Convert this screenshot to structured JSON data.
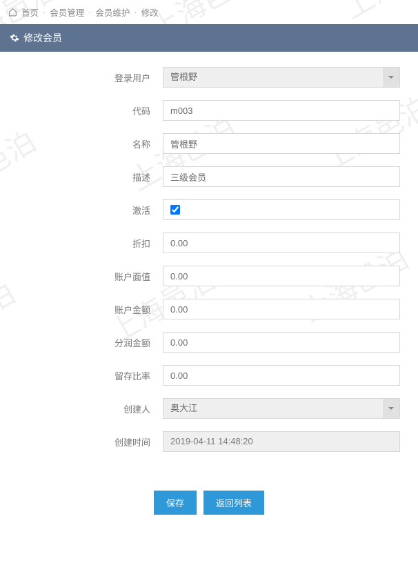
{
  "watermark_text": "上海邑泊",
  "breadcrumb": {
    "home": "首页",
    "l1": "会员管理",
    "l2": "会员维护",
    "l3": "修改"
  },
  "panel": {
    "title": "修改会员"
  },
  "form": {
    "login_user": {
      "label": "登录用户",
      "value": "管根野"
    },
    "code": {
      "label": "代码",
      "value": "m003"
    },
    "name": {
      "label": "名称",
      "value": "管根野"
    },
    "desc": {
      "label": "描述",
      "value": "三级会员"
    },
    "active": {
      "label": "激活",
      "checked": true
    },
    "discount": {
      "label": "折扣",
      "value": "0.00"
    },
    "face_value": {
      "label": "账户面值",
      "value": "0.00"
    },
    "balance": {
      "label": "账户金额",
      "value": "0.00"
    },
    "profit": {
      "label": "分润金额",
      "value": "0.00"
    },
    "retain": {
      "label": "留存比率",
      "value": "0.00"
    },
    "creator": {
      "label": "创建人",
      "value": "奥大江"
    },
    "created_at": {
      "label": "创建时间",
      "value": "2019-04-11 14:48:20"
    }
  },
  "buttons": {
    "save": "保存",
    "back": "返回列表"
  }
}
